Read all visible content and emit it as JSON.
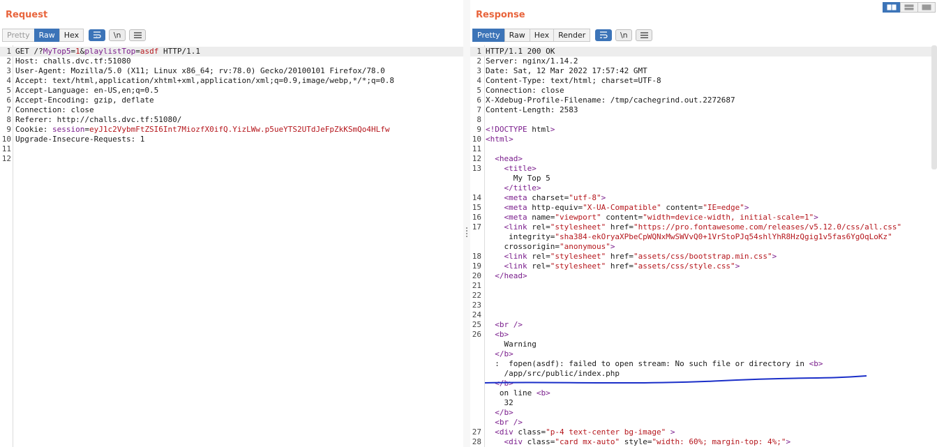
{
  "request": {
    "title": "Request",
    "tabs": [
      "Pretty",
      "Raw",
      "Hex"
    ],
    "active_tab": "Raw",
    "tool_icons": [
      "wrap-icon",
      "newline-icon",
      "menu-icon"
    ],
    "newline_label": "\\n",
    "lines": [
      {
        "n": "1",
        "tokens": [
          [
            "k",
            "GET /?"
          ],
          [
            "t",
            "MyTop5"
          ],
          [
            "k",
            "="
          ],
          [
            "s",
            "1"
          ],
          [
            "k",
            "&"
          ],
          [
            "t",
            "playlistTop"
          ],
          [
            "k",
            "="
          ],
          [
            "s",
            "asdf"
          ],
          [
            "k",
            " HTTP/1.1"
          ]
        ]
      },
      {
        "n": "2",
        "tokens": [
          [
            "k",
            "Host: challs.dvc.tf:51080"
          ]
        ]
      },
      {
        "n": "3",
        "tokens": [
          [
            "k",
            "User-Agent: Mozilla/5.0 (X11; Linux x86_64; rv:78.0) Gecko/20100101 Firefox/78.0"
          ]
        ]
      },
      {
        "n": "4",
        "tokens": [
          [
            "k",
            "Accept: text/html,application/xhtml+xml,application/xml;q=0.9,image/webp,*/*;q=0.8"
          ]
        ]
      },
      {
        "n": "5",
        "tokens": [
          [
            "k",
            "Accept-Language: en-US,en;q=0.5"
          ]
        ]
      },
      {
        "n": "6",
        "tokens": [
          [
            "k",
            "Accept-Encoding: gzip, deflate"
          ]
        ]
      },
      {
        "n": "7",
        "tokens": [
          [
            "k",
            "Connection: close"
          ]
        ]
      },
      {
        "n": "8",
        "tokens": [
          [
            "k",
            "Referer: http://challs.dvc.tf:51080/"
          ]
        ]
      },
      {
        "n": "9",
        "tokens": [
          [
            "k",
            "Cookie: "
          ],
          [
            "t",
            "session"
          ],
          [
            "k",
            "="
          ],
          [
            "s",
            "eyJ1c2VybmFtZSI6Int7MiozfX0ifQ.YizLWw.p5ueYTS2UTdJeFpZkKSmQo4HLfw"
          ]
        ]
      },
      {
        "n": "10",
        "tokens": [
          [
            "k",
            "Upgrade-Insecure-Requests: 1"
          ]
        ]
      },
      {
        "n": "11",
        "tokens": []
      },
      {
        "n": "12",
        "tokens": []
      }
    ]
  },
  "response": {
    "title": "Response",
    "tabs": [
      "Pretty",
      "Raw",
      "Hex",
      "Render"
    ],
    "active_tab": "Pretty",
    "tool_icons": [
      "wrap-icon",
      "newline-icon",
      "menu-icon"
    ],
    "newline_label": "\\n",
    "lines": [
      {
        "n": "1",
        "tokens": [
          [
            "k",
            "HTTP/1.1 200 OK"
          ]
        ]
      },
      {
        "n": "2",
        "tokens": [
          [
            "k",
            "Server: nginx/1.14.2"
          ]
        ]
      },
      {
        "n": "3",
        "tokens": [
          [
            "k",
            "Date: Sat, 12 Mar 2022 17:57:42 GMT"
          ]
        ]
      },
      {
        "n": "4",
        "tokens": [
          [
            "k",
            "Content-Type: text/html; charset=UTF-8"
          ]
        ]
      },
      {
        "n": "5",
        "tokens": [
          [
            "k",
            "Connection: close"
          ]
        ]
      },
      {
        "n": "6",
        "tokens": [
          [
            "k",
            "X-Xdebug-Profile-Filename: /tmp/cachegrind.out.2272687"
          ]
        ]
      },
      {
        "n": "7",
        "tokens": [
          [
            "k",
            "Content-Length: 2583"
          ]
        ]
      },
      {
        "n": "8",
        "tokens": []
      },
      {
        "n": "9",
        "tokens": [
          [
            "t",
            "<!DOCTYPE"
          ],
          [
            "k",
            " html"
          ],
          [
            "t",
            ">"
          ]
        ]
      },
      {
        "n": "10",
        "tokens": [
          [
            "t",
            "<html>"
          ]
        ]
      },
      {
        "n": "11",
        "tokens": []
      },
      {
        "n": "12",
        "tokens": [
          [
            "k",
            "  "
          ],
          [
            "t",
            "<head>"
          ]
        ]
      },
      {
        "n": "13",
        "tokens": [
          [
            "k",
            "    "
          ],
          [
            "t",
            "<title>"
          ]
        ]
      },
      {
        "n": "",
        "tokens": [
          [
            "k",
            "      My Top 5"
          ]
        ]
      },
      {
        "n": "",
        "tokens": [
          [
            "k",
            "    "
          ],
          [
            "t",
            "</title>"
          ]
        ]
      },
      {
        "n": "14",
        "tokens": [
          [
            "k",
            "    "
          ],
          [
            "t",
            "<meta"
          ],
          [
            "k",
            " charset="
          ],
          [
            "s",
            "\"utf-8\""
          ],
          [
            "t",
            ">"
          ]
        ]
      },
      {
        "n": "15",
        "tokens": [
          [
            "k",
            "    "
          ],
          [
            "t",
            "<meta"
          ],
          [
            "k",
            " http-equiv="
          ],
          [
            "s",
            "\"X-UA-Compatible\""
          ],
          [
            "k",
            " content="
          ],
          [
            "s",
            "\"IE=edge\""
          ],
          [
            "t",
            ">"
          ]
        ]
      },
      {
        "n": "16",
        "tokens": [
          [
            "k",
            "    "
          ],
          [
            "t",
            "<meta"
          ],
          [
            "k",
            " name="
          ],
          [
            "s",
            "\"viewport\""
          ],
          [
            "k",
            " content="
          ],
          [
            "s",
            "\"width=device-width, initial-scale=1\""
          ],
          [
            "t",
            ">"
          ]
        ]
      },
      {
        "n": "17",
        "tokens": [
          [
            "k",
            "    "
          ],
          [
            "t",
            "<link"
          ],
          [
            "k",
            " rel="
          ],
          [
            "s",
            "\"stylesheet\""
          ],
          [
            "k",
            " href="
          ],
          [
            "s",
            "\"https://pro.fontawesome.com/releases/v5.12.0/css/all.css\""
          ]
        ]
      },
      {
        "n": "",
        "tokens": [
          [
            "k",
            "     integrity="
          ],
          [
            "s",
            "\"sha384-ekOryaXPbeCpWQNxMwSWVvQ0+1VrStoPJq54shlYhR8HzQgig1v5fas6YgOqLoKz\""
          ]
        ]
      },
      {
        "n": "",
        "tokens": [
          [
            "k",
            "    crossorigin="
          ],
          [
            "s",
            "\"anonymous\""
          ],
          [
            "t",
            ">"
          ]
        ]
      },
      {
        "n": "18",
        "tokens": [
          [
            "k",
            "    "
          ],
          [
            "t",
            "<link"
          ],
          [
            "k",
            " rel="
          ],
          [
            "s",
            "\"stylesheet\""
          ],
          [
            "k",
            " href="
          ],
          [
            "s",
            "\"assets/css/bootstrap.min.css\""
          ],
          [
            "t",
            ">"
          ]
        ]
      },
      {
        "n": "19",
        "tokens": [
          [
            "k",
            "    "
          ],
          [
            "t",
            "<link"
          ],
          [
            "k",
            " rel="
          ],
          [
            "s",
            "\"stylesheet\""
          ],
          [
            "k",
            " href="
          ],
          [
            "s",
            "\"assets/css/style.css\""
          ],
          [
            "t",
            ">"
          ]
        ]
      },
      {
        "n": "20",
        "tokens": [
          [
            "k",
            "  "
          ],
          [
            "t",
            "</head>"
          ]
        ]
      },
      {
        "n": "21",
        "tokens": []
      },
      {
        "n": "22",
        "tokens": []
      },
      {
        "n": "23",
        "tokens": []
      },
      {
        "n": "24",
        "tokens": []
      },
      {
        "n": "25",
        "tokens": [
          [
            "k",
            "  "
          ],
          [
            "t",
            "<br />"
          ]
        ]
      },
      {
        "n": "26",
        "tokens": [
          [
            "k",
            "  "
          ],
          [
            "t",
            "<b>"
          ]
        ]
      },
      {
        "n": "",
        "tokens": [
          [
            "k",
            "    Warning"
          ]
        ]
      },
      {
        "n": "",
        "tokens": [
          [
            "k",
            "  "
          ],
          [
            "t",
            "</b>"
          ]
        ]
      },
      {
        "n": "",
        "tokens": [
          [
            "k",
            "  :  fopen(asdf): failed to open stream: No such file or directory in "
          ],
          [
            "t",
            "<b>"
          ]
        ]
      },
      {
        "n": "",
        "tokens": [
          [
            "k",
            "    /app/src/public/index.php"
          ]
        ]
      },
      {
        "n": "",
        "tokens": [
          [
            "k",
            "  "
          ],
          [
            "t",
            "</b>"
          ]
        ]
      },
      {
        "n": "",
        "tokens": [
          [
            "k",
            "   on line "
          ],
          [
            "t",
            "<b>"
          ]
        ]
      },
      {
        "n": "",
        "tokens": [
          [
            "k",
            "    32"
          ]
        ]
      },
      {
        "n": "",
        "tokens": [
          [
            "k",
            "  "
          ],
          [
            "t",
            "</b>"
          ]
        ]
      },
      {
        "n": "",
        "tokens": [
          [
            "k",
            "  "
          ],
          [
            "t",
            "<br />"
          ]
        ]
      },
      {
        "n": "27",
        "tokens": [
          [
            "k",
            "  "
          ],
          [
            "t",
            "<div"
          ],
          [
            "k",
            " class="
          ],
          [
            "s",
            "\"p-4 text-center bg-image\""
          ],
          [
            "k",
            " "
          ],
          [
            "t",
            ">"
          ]
        ]
      },
      {
        "n": "28",
        "tokens": [
          [
            "k",
            "    "
          ],
          [
            "t",
            "<div"
          ],
          [
            "k",
            " class="
          ],
          [
            "s",
            "\"card mx-auto\""
          ],
          [
            "k",
            " style="
          ],
          [
            "s",
            "\"width: 60%; margin-top: 4%;\""
          ],
          [
            "t",
            ">"
          ]
        ]
      }
    ]
  },
  "layout_buttons": [
    "split-horizontal-icon",
    "split-vertical-icon",
    "tabs-icon"
  ],
  "annotation_color": "#1a2ec8"
}
